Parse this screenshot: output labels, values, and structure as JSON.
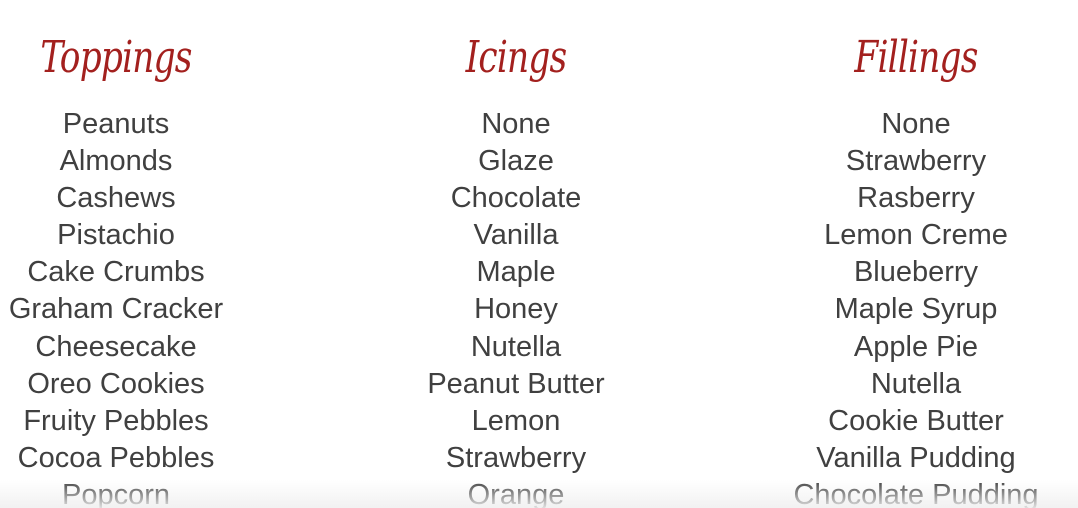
{
  "colors": {
    "heading": "#a3201e",
    "item": "#404040",
    "background": "#ffffff"
  },
  "columns": [
    {
      "title": "Toppings",
      "items": [
        "Peanuts",
        "Almonds",
        "Cashews",
        "Pistachio",
        "Cake Crumbs",
        "Graham Cracker",
        "Cheesecake",
        "Oreo Cookies",
        "Fruity Pebbles",
        "Cocoa Pebbles",
        "Popcorn"
      ]
    },
    {
      "title": "Icings",
      "items": [
        "None",
        "Glaze",
        "Chocolate",
        "Vanilla",
        "Maple",
        "Honey",
        "Nutella",
        "Peanut Butter",
        "Lemon",
        "Strawberry",
        "Orange"
      ]
    },
    {
      "title": "Fillings",
      "items": [
        "None",
        "Strawberry",
        "Rasberry",
        "Lemon Creme",
        "Blueberry",
        "Maple Syrup",
        "Apple Pie",
        "Nutella",
        "Cookie Butter",
        "Vanilla Pudding",
        "Chocolate Pudding"
      ]
    }
  ]
}
